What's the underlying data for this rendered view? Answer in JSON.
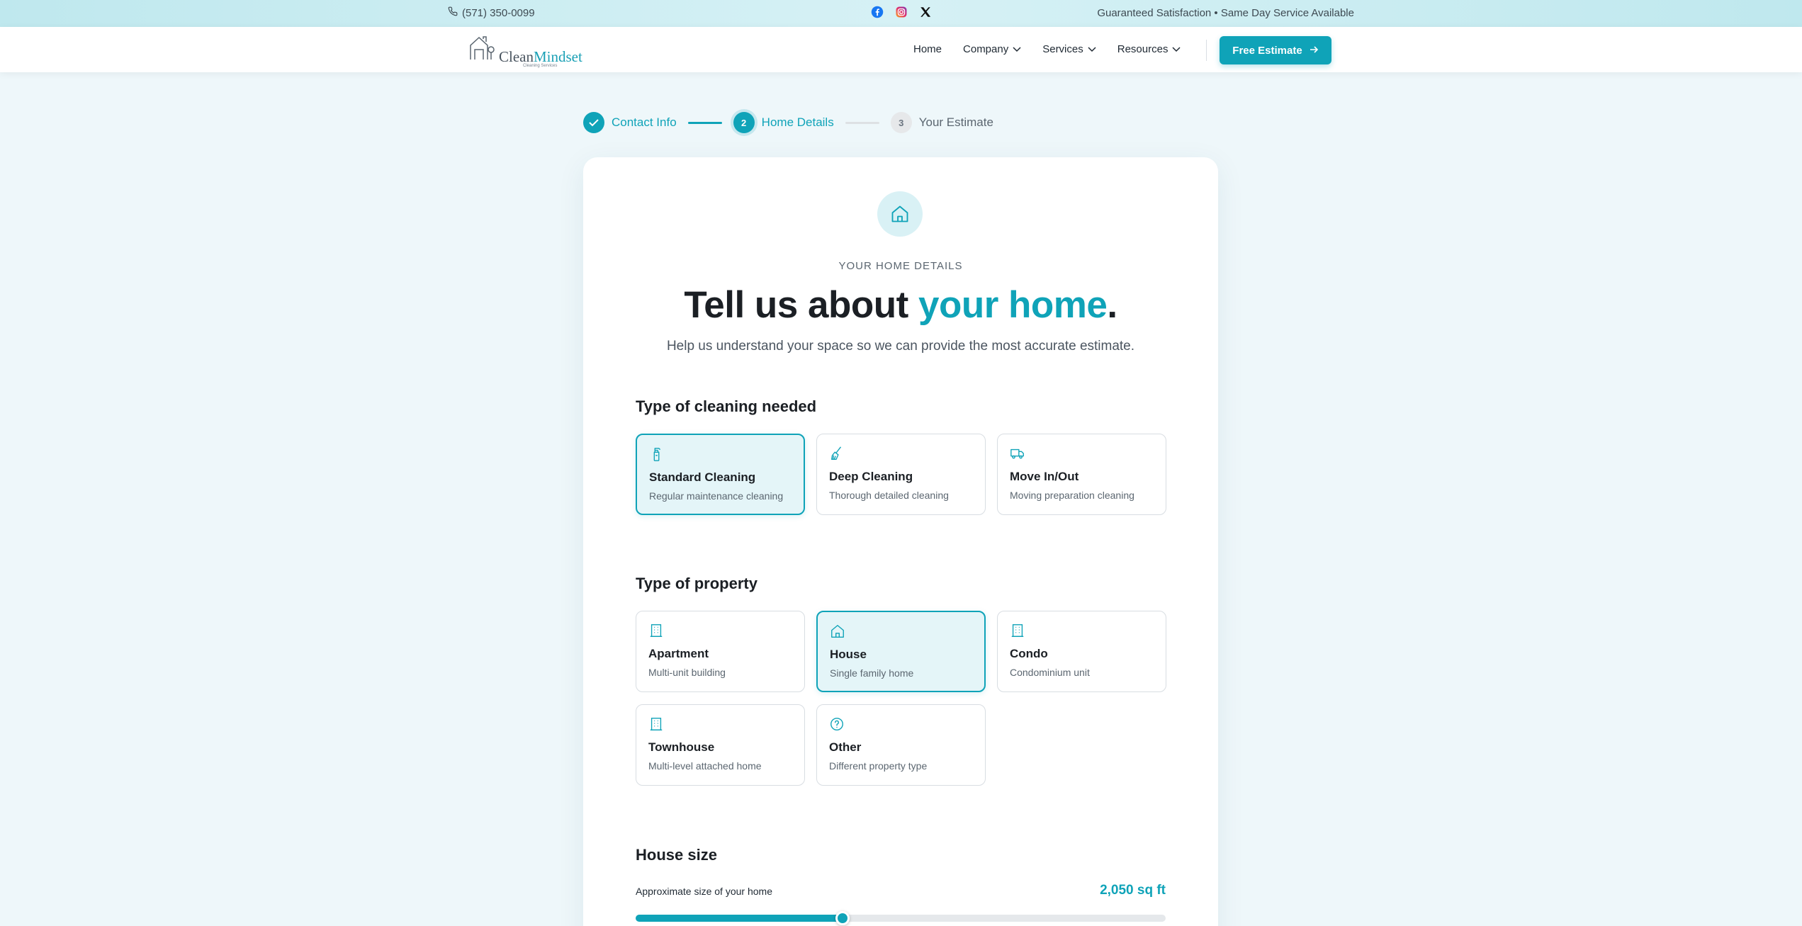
{
  "topbar": {
    "phone": "(571) 350-0099",
    "tagline": "Guaranteed Satisfaction • Same Day Service Available",
    "socials": [
      "facebook-icon",
      "instagram-icon",
      "x-icon"
    ]
  },
  "nav": {
    "logo_main": "Clean",
    "logo_accent": "Mindset",
    "logo_sub": "Cleaning Services",
    "links": [
      {
        "label": "Home",
        "dropdown": false
      },
      {
        "label": "Company",
        "dropdown": true
      },
      {
        "label": "Services",
        "dropdown": true
      },
      {
        "label": "Resources",
        "dropdown": true
      }
    ],
    "cta_label": "Free Estimate"
  },
  "stepper": {
    "steps": [
      {
        "number": "✓",
        "label": "Contact Info",
        "state": "done"
      },
      {
        "number": "2",
        "label": "Home Details",
        "state": "active"
      },
      {
        "number": "3",
        "label": "Your Estimate",
        "state": "todo"
      }
    ]
  },
  "card": {
    "eyebrow": "YOUR HOME DETAILS",
    "headline_start": "Tell us about ",
    "headline_accent": "your home",
    "headline_end": ".",
    "subhead": "Help us understand your space so we can provide the most accurate estimate.",
    "cleaning": {
      "title": "Type of cleaning needed",
      "options": [
        {
          "icon": "spray-bottle-icon",
          "title": "Standard Cleaning",
          "desc": "Regular maintenance cleaning",
          "selected": true
        },
        {
          "icon": "broom-icon",
          "title": "Deep Cleaning",
          "desc": "Thorough detailed cleaning",
          "selected": false
        },
        {
          "icon": "truck-icon",
          "title": "Move In/Out",
          "desc": "Moving preparation cleaning",
          "selected": false
        }
      ]
    },
    "property": {
      "title": "Type of property",
      "options": [
        {
          "icon": "building-icon",
          "title": "Apartment",
          "desc": "Multi-unit building",
          "selected": false
        },
        {
          "icon": "house-icon",
          "title": "House",
          "desc": "Single family home",
          "selected": true
        },
        {
          "icon": "building-icon",
          "title": "Condo",
          "desc": "Condominium unit",
          "selected": false
        },
        {
          "icon": "building-icon",
          "title": "Townhouse",
          "desc": "Multi-level attached home",
          "selected": false
        },
        {
          "icon": "question-circle-icon",
          "title": "Other",
          "desc": "Different property type",
          "selected": false
        }
      ]
    },
    "size": {
      "title": "House size",
      "label": "Approximate size of your home",
      "value": "2,050 sq ft",
      "fraction": 0.39
    }
  },
  "colors": {
    "accent": "#0fa3b8",
    "selected_bg": "#e4f5f8",
    "page_bg": "#eef7fa"
  }
}
